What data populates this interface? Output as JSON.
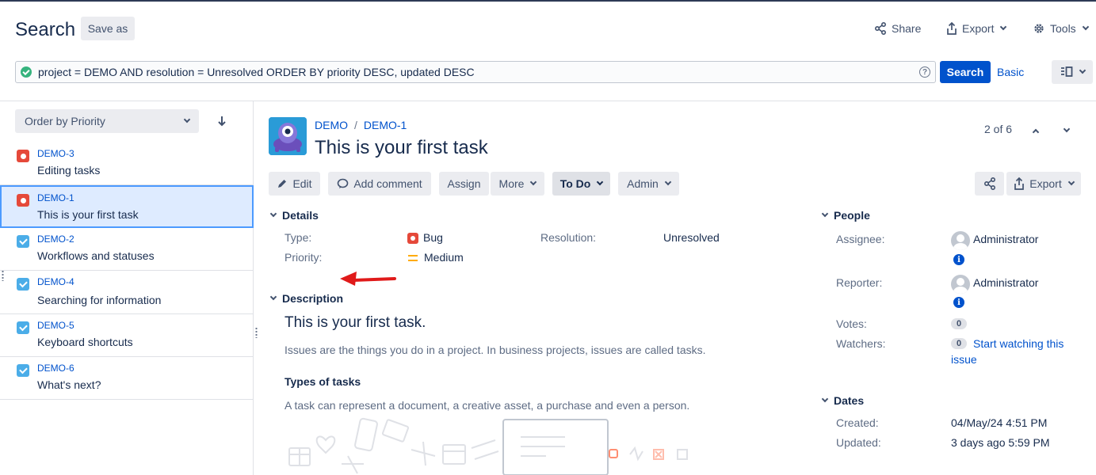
{
  "header": {
    "title": "Search",
    "save_as": "Save as",
    "share": "Share",
    "export": "Export",
    "tools": "Tools"
  },
  "search": {
    "query": "project = DEMO AND resolution = Unresolved ORDER BY priority DESC, updated DESC",
    "help": "?",
    "search_button": "Search",
    "basic_link": "Basic"
  },
  "sidebar": {
    "order_by": "Order by Priority",
    "issues": [
      {
        "key": "DEMO-3",
        "summary": "Editing tasks",
        "type": "bug"
      },
      {
        "key": "DEMO-1",
        "summary": "This is your first task",
        "type": "bug",
        "selected": true
      },
      {
        "key": "DEMO-2",
        "summary": "Workflows and statuses",
        "type": "task"
      },
      {
        "key": "DEMO-4",
        "summary": "Searching for information",
        "type": "task"
      },
      {
        "key": "DEMO-5",
        "summary": "Keyboard shortcuts",
        "type": "task"
      },
      {
        "key": "DEMO-6",
        "summary": "What's next?",
        "type": "task"
      }
    ]
  },
  "issue": {
    "project": "DEMO",
    "key": "DEMO-1",
    "title": "This is your first task",
    "pager": "2 of 6",
    "toolbar": {
      "edit": "Edit",
      "add_comment": "Add comment",
      "assign": "Assign",
      "more": "More",
      "status": "To Do",
      "admin": "Admin",
      "export": "Export"
    },
    "details": {
      "heading": "Details",
      "type_label": "Type:",
      "type_value": "Bug",
      "priority_label": "Priority:",
      "priority_value": "Medium",
      "resolution_label": "Resolution:",
      "resolution_value": "Unresolved"
    },
    "description": {
      "heading": "Description",
      "h1": "This is your first task.",
      "p1": "Issues are the things you do in a project. In business projects, issues are called tasks.",
      "h3": "Types of tasks",
      "p2": "A task can represent a document, a creative asset, a purchase and even a person."
    },
    "people": {
      "heading": "People",
      "assignee_label": "Assignee:",
      "assignee": "Administrator",
      "reporter_label": "Reporter:",
      "reporter": "Administrator",
      "votes_label": "Votes:",
      "votes": "0",
      "watchers_label": "Watchers:",
      "watchers": "0",
      "watch_line1": "Start watching this",
      "watch_line2": "issue"
    },
    "dates": {
      "heading": "Dates",
      "created_label": "Created:",
      "created": "04/May/24 4:51 PM",
      "updated_label": "Updated:",
      "updated": "3 days ago 5:59 PM"
    }
  },
  "colors": {
    "brand": "#0052cc",
    "bug": "#e5493a",
    "task": "#4bade8",
    "priority_medium": "#ffab00",
    "annotation_arrow": "#e01a1a"
  }
}
